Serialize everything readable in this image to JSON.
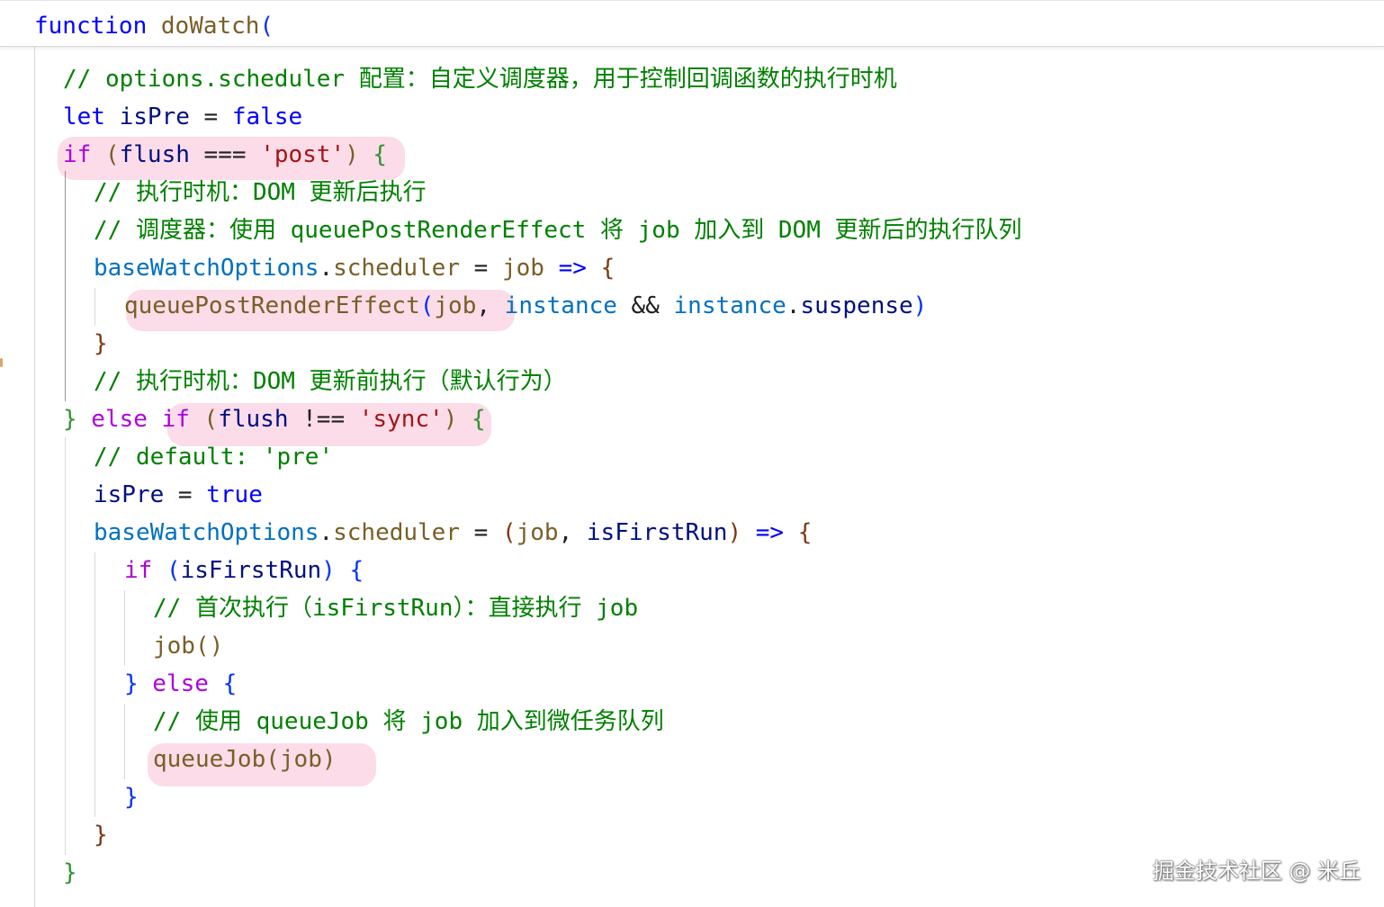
{
  "sticky_header": {
    "keyword": "function",
    "name": "doWatch",
    "paren": "("
  },
  "code_lines": [
    {
      "tokens": [
        {
          "t": "// options.scheduler 配置：自定义调度器，用于控制回调函数的执行时机",
          "c": "cm"
        }
      ]
    },
    {
      "tokens": [
        {
          "t": "let",
          "c": "kw"
        },
        {
          "t": " isPre ",
          "c": "var"
        },
        {
          "t": "= ",
          "c": "op"
        },
        {
          "t": "false",
          "c": "kw"
        }
      ]
    },
    {
      "tokens": [
        {
          "t": "if",
          "c": "ctl"
        },
        {
          "t": " (",
          "c": "fn"
        },
        {
          "t": "flush",
          "c": "var"
        },
        {
          "t": " === ",
          "c": "op"
        },
        {
          "t": "'post'",
          "c": "str"
        },
        {
          "t": ")",
          "c": "fn"
        },
        {
          "t": " {",
          "c": "b2"
        }
      ]
    },
    {
      "tokens": [
        {
          "t": "// 执行时机：DOM 更新后执行",
          "c": "cm"
        }
      ]
    },
    {
      "tokens": [
        {
          "t": "// 调度器：使用 queuePostRenderEffect 将 job 加入到 DOM 更新后的执行队列",
          "c": "cm"
        }
      ]
    },
    {
      "tokens": [
        {
          "t": "baseWatchOptions",
          "c": "prop"
        },
        {
          "t": ".",
          "c": "op"
        },
        {
          "t": "scheduler",
          "c": "fn"
        },
        {
          "t": " = ",
          "c": "op"
        },
        {
          "t": "job",
          "c": "fn"
        },
        {
          "t": " => ",
          "c": "kw"
        },
        {
          "t": "{",
          "c": "b3"
        }
      ]
    },
    {
      "tokens": [
        {
          "t": "queuePostRenderEffect",
          "c": "fn"
        },
        {
          "t": "(",
          "c": "b1"
        },
        {
          "t": "job",
          "c": "fn"
        },
        {
          "t": ", ",
          "c": "op"
        },
        {
          "t": "instance",
          "c": "prop"
        },
        {
          "t": " && ",
          "c": "op"
        },
        {
          "t": "instance",
          "c": "prop"
        },
        {
          "t": ".",
          "c": "op"
        },
        {
          "t": "suspense",
          "c": "var"
        },
        {
          "t": ")",
          "c": "b1"
        }
      ]
    },
    {
      "tokens": [
        {
          "t": "}",
          "c": "b3"
        }
      ]
    },
    {
      "tokens": [
        {
          "t": "// 执行时机：DOM 更新前执行（默认行为）",
          "c": "cm"
        }
      ]
    },
    {
      "tokens": [
        {
          "t": "}",
          "c": "b2"
        },
        {
          "t": " else ",
          "c": "ctl"
        },
        {
          "t": "if",
          "c": "ctl"
        },
        {
          "t": " (",
          "c": "fn"
        },
        {
          "t": "flush",
          "c": "var"
        },
        {
          "t": " !== ",
          "c": "op"
        },
        {
          "t": "'sync'",
          "c": "str"
        },
        {
          "t": ")",
          "c": "fn"
        },
        {
          "t": " {",
          "c": "b2"
        }
      ]
    },
    {
      "tokens": [
        {
          "t": "// default: 'pre'",
          "c": "cm"
        }
      ]
    },
    {
      "tokens": [
        {
          "t": "isPre",
          "c": "var"
        },
        {
          "t": " = ",
          "c": "op"
        },
        {
          "t": "true",
          "c": "kw"
        }
      ]
    },
    {
      "tokens": [
        {
          "t": "baseWatchOptions",
          "c": "prop"
        },
        {
          "t": ".",
          "c": "op"
        },
        {
          "t": "scheduler",
          "c": "fn"
        },
        {
          "t": " = ",
          "c": "op"
        },
        {
          "t": "(",
          "c": "b3"
        },
        {
          "t": "job",
          "c": "fn"
        },
        {
          "t": ", ",
          "c": "op"
        },
        {
          "t": "isFirstRun",
          "c": "var"
        },
        {
          "t": ")",
          "c": "b3"
        },
        {
          "t": " => ",
          "c": "kw"
        },
        {
          "t": "{",
          "c": "b3"
        }
      ]
    },
    {
      "tokens": [
        {
          "t": "if",
          "c": "ctl"
        },
        {
          "t": " (",
          "c": "b1"
        },
        {
          "t": "isFirstRun",
          "c": "var"
        },
        {
          "t": ")",
          "c": "b1"
        },
        {
          "t": " {",
          "c": "b1"
        }
      ]
    },
    {
      "tokens": [
        {
          "t": "// 首次执行（isFirstRun）：直接执行 job",
          "c": "cm"
        }
      ]
    },
    {
      "tokens": [
        {
          "t": "job",
          "c": "fn"
        },
        {
          "t": "()",
          "c": "fn"
        }
      ]
    },
    {
      "tokens": [
        {
          "t": "}",
          "c": "b1"
        },
        {
          "t": " else ",
          "c": "ctl"
        },
        {
          "t": "{",
          "c": "b1"
        }
      ]
    },
    {
      "tokens": [
        {
          "t": "// 使用 queueJob 将 job 加入到微任务队列",
          "c": "cm"
        }
      ]
    },
    {
      "tokens": [
        {
          "t": "queueJob",
          "c": "fn"
        },
        {
          "t": "(",
          "c": "fn"
        },
        {
          "t": "job",
          "c": "fn"
        },
        {
          "t": ")",
          "c": "fn"
        }
      ]
    },
    {
      "tokens": [
        {
          "t": "}",
          "c": "b1"
        }
      ]
    },
    {
      "tokens": [
        {
          "t": "}",
          "c": "b3"
        }
      ]
    },
    {
      "tokens": [
        {
          "t": "}",
          "c": "b2"
        }
      ]
    }
  ],
  "watermark": "掘金技术社区 @ 米丘"
}
